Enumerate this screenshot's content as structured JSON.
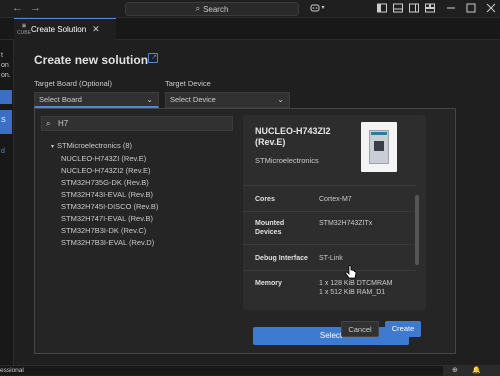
{
  "titlebar": {
    "back_arrow": "←",
    "forward_arrow": "→",
    "search_icon": "⌕",
    "search_text": "Search",
    "copilot_icon": "copilot-icon",
    "layout_icons": [
      "toggle-primary-sidebar-icon",
      "toggle-panel-icon",
      "toggle-secondary-sidebar-icon",
      "customize-layout-icon"
    ],
    "window_icons": [
      "minimize-icon",
      "maximize-icon",
      "close-icon"
    ]
  },
  "tab": {
    "title": "Create Solution",
    "icon_text": "CUBE",
    "close": "✕"
  },
  "left_strip": {
    "fragments": [
      "t",
      "on",
      "on.",
      "S",
      "d"
    ]
  },
  "page": {
    "title": "Create new solution",
    "link_icon": "↗"
  },
  "form": {
    "target_board_label": "Target Board (Optional)",
    "target_board_value": "Select Board",
    "target_device_label": "Target Device",
    "target_device_value": "Select Device",
    "chevron": "⌄"
  },
  "board_picker": {
    "filter_value": "H7",
    "filter_icon": "⌕",
    "group": {
      "label": "STMicroelectronics (8)",
      "chevron": "▾"
    },
    "items": [
      "NUCLEO-H743ZI (Rev.E)",
      "NUCLEO-H743ZI2 (Rev.E)",
      "STM32H735G-DK (Rev.B)",
      "STM32H743I-EVAL (Rev.B)",
      "STM32H745I-DISCO (Rev.B)",
      "STM32H747I-EVAL (Rev.B)",
      "STM32H7B3I-DK (Rev.C)",
      "STM32H7B3I-EVAL (Rev.D)"
    ]
  },
  "details": {
    "name": "NUCLEO-H743ZI2 (Rev.E)",
    "vendor": "STMicroelectronics",
    "rows": [
      {
        "key": "Cores",
        "value": "Cortex-M7"
      },
      {
        "key": "Mounted Devices",
        "value": "STM32H743ZITx"
      },
      {
        "key": "Debug Interface",
        "value": "ST-Link"
      },
      {
        "key": "Memory",
        "value": "1 x 128 KiB DTCMRAM"
      }
    ],
    "memory_overflow": "1 x 512 KiB RAM_D1",
    "select_label": "Select"
  },
  "actions": {
    "cancel": "Cancel",
    "create": "Create"
  },
  "statusbar": {
    "left_text": "essional",
    "zoom_icon": "⊕",
    "bell_icon": "🔔"
  }
}
